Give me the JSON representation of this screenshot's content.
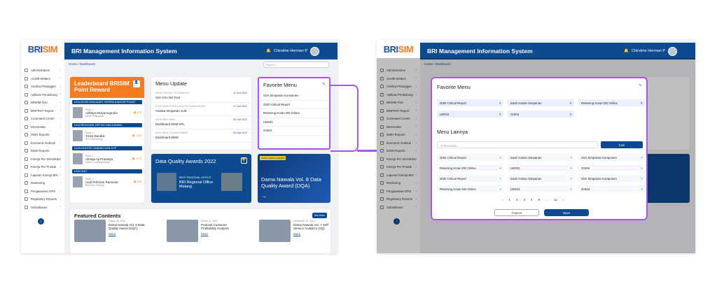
{
  "app": {
    "logo": "BRI",
    "logo_accent": "SIM",
    "title": "BRI Management Information System",
    "user": "Chirstine Herman P",
    "breadcrumb": "Home / Dashboard"
  },
  "sidebar": [
    "Administration",
    "ALMM Matters",
    "Analisa Pelanggan",
    "Aplikasi Pendukung",
    "BRIMM Fian",
    "BRIFRST Report",
    "Command Center",
    "Directorate",
    "DWH Reports",
    "Economic Outlook",
    "EDW Reports",
    "Kinerja Per Divisi/Kber",
    "Kinerja Per Produk",
    "Laporan Kinerja BRI",
    "Monitoring",
    "Pengawasan OPS",
    "Regulatory Reports",
    "Subsidiaries"
  ],
  "leaderboard": {
    "title": "Leaderboard BRISIM Point Reward",
    "sections": [
      {
        "label": "LIGA DIVISI DAN AUDIT INTERN KANTOR PUSAT",
        "rank": "Rank 1",
        "name": "Adhitya Mulyomugroho",
        "org": "Divisi Pelaksana",
        "points": "875"
      },
      {
        "label": "LIGA REGIONAL OFFICE DAN KANWIL",
        "rank": "Rank 1",
        "name": "Tresa Dandra",
        "org": "RO Palembang",
        "points": "1700"
      },
      {
        "label": "LIGA KANTOR CABANG DAN KCP",
        "rank": "Rank 1",
        "name": "Atmaja Aji Prasetya",
        "org": "Kantor Cabang Bantul",
        "points": "1270"
      },
      {
        "label": "LIGA UNIT",
        "rank": "Rank 1",
        "name": "Andi Rohman Ramunia",
        "org": "BRI Unit Garlung",
        "points": "975"
      }
    ]
  },
  "menu_update": {
    "title": "Menu Update",
    "items": [
      {
        "cat": "DIVISI TRANSACTION BANKING",
        "name": "SSA Giro Not Pool",
        "date": "11 Juni 2022"
      },
      {
        "cat": "DIVISI ASSETS AND LIABILITIES MANAGEMENT",
        "name": "Analisa Simpanan ALM",
        "date": "17 Juni 2022"
      },
      {
        "cat": "DIVISI WMS WBKD",
        "name": "Dashboard MSM NPL",
        "date": "26 Juni 2022"
      },
      {
        "cat": "DIVISI WEALTH MANAGEMENT",
        "name": "Dashboard WMG",
        "date": "05 Juni 2022"
      }
    ]
  },
  "favorite_menu": {
    "title": "Favorite Menu",
    "items": [
      "SSA Simpanan Konsumen",
      "2020 Critical Report",
      "Rekening Koran DD Online",
      "LWS31",
      "GIS04"
    ]
  },
  "dqa": {
    "title": "Data Quality Awards 2022",
    "sub": "BEST REGIONAL OFFICE",
    "winner": "BRI Regional Office Malang"
  },
  "series": {
    "badge": "DAMA NAWALA SERIES",
    "title": "Dama Nawala Vol. 8 Data Quality Award (DQA)"
  },
  "featured": {
    "title": "Featured Contents",
    "see_more": "See More",
    "items": [
      {
        "date": "March 20, 2022",
        "title": "Dama Nawala Vol. 8 Data Quality Award (DQA)",
        "more": "More"
      },
      {
        "date": "March 11, 2022",
        "title": "Podcast Customer Profitability Analysis",
        "more": "More"
      },
      {
        "date": "December 10, 2022",
        "title": "Dama Nawala Vol. 7 Self Service Analytics (SQ)",
        "more": "More"
      }
    ]
  },
  "search_placeholder": "Search...",
  "modal": {
    "title": "Favorite Menu",
    "favorites": [
      "2020 Critical Report",
      "Dash Harian Simpanan",
      "Rekening Koran DD Online",
      "LWS31",
      "GIS04"
    ],
    "other_title": "Menu Lainnya",
    "search_placeholder": "Pencarian...",
    "search_btn": "Cari",
    "others": [
      "2020 Critical Report",
      "Dash Harian Simpanan",
      "SSA Simpanan Komponen",
      "Rekening Koran DD Online",
      "LWS31",
      "GIS04",
      "2020 Critical Report",
      "Dash Harian Simpanan",
      "SSA Simpanan Komponen",
      "Rekening Koran DD Online",
      "LWS31",
      "GIS04"
    ],
    "pages": [
      "1",
      "2",
      "3",
      "4",
      "5",
      "...",
      "12"
    ],
    "cancel": "Cancel",
    "save": "Save"
  }
}
